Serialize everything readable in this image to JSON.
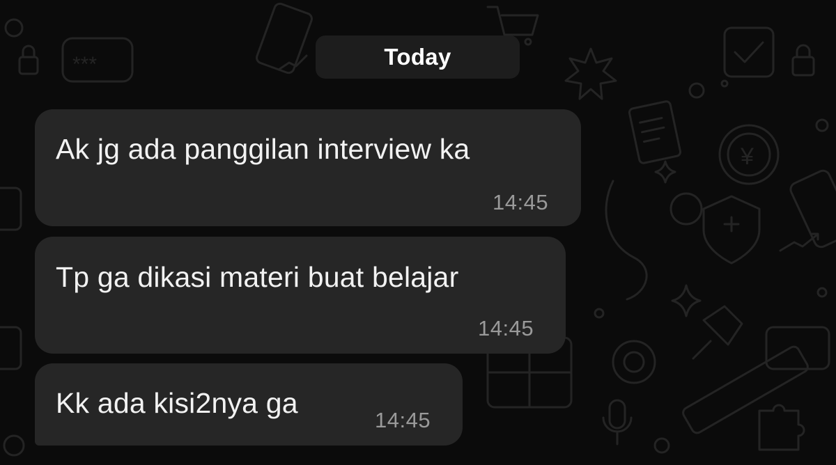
{
  "chat": {
    "date_label": "Today",
    "messages": [
      {
        "text": "Ak jg ada panggilan interview ka",
        "time": "14:45"
      },
      {
        "text": "Tp ga dikasi materi buat belajar",
        "time": "14:45"
      },
      {
        "text": "Kk ada kisi2nya ga",
        "time": "14:45"
      }
    ]
  },
  "colors": {
    "background": "#0b0b0b",
    "bubble": "#262626",
    "date_pill": "#1d1d1d",
    "text": "#f2f2f2",
    "timestamp": "#9a9a9a",
    "doodle": "#232323"
  },
  "icons": [
    "chat-wallpaper-doodle-pattern"
  ]
}
